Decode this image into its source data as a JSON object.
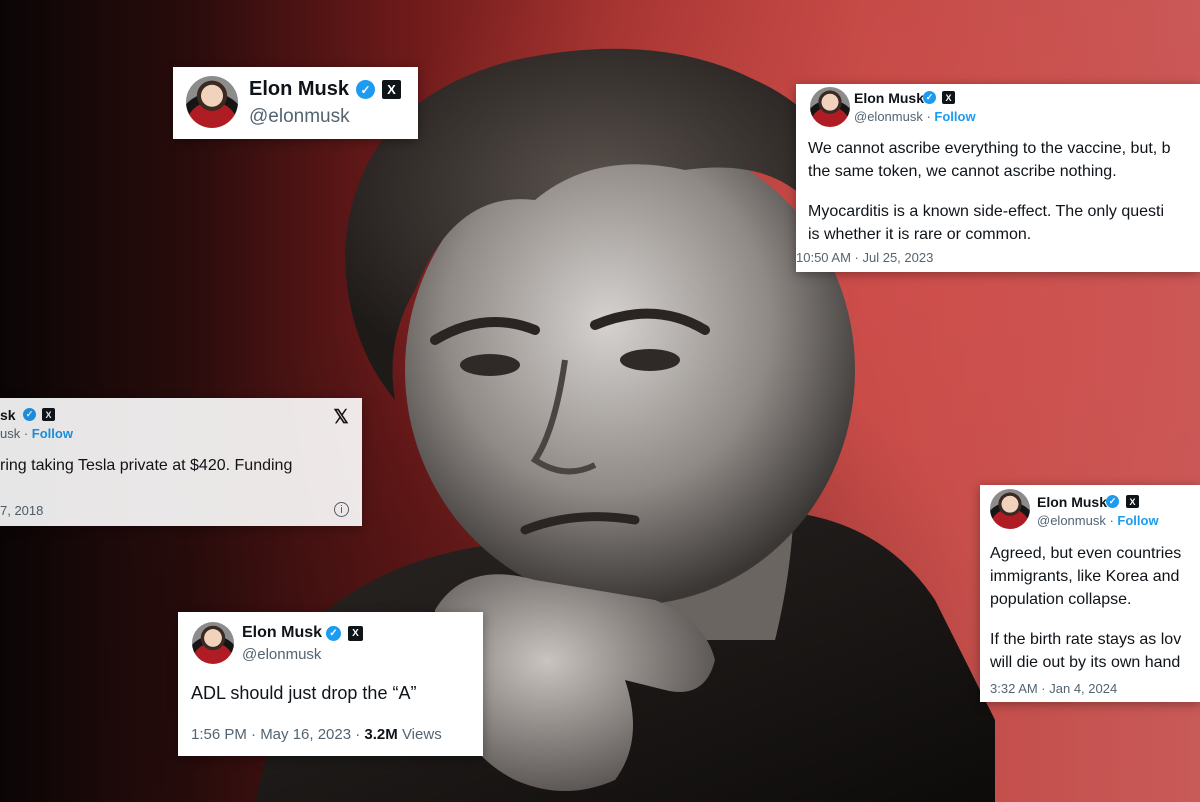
{
  "author": {
    "name": "Elon Musk",
    "handle": "@elonmusk",
    "follow_label": "Follow"
  },
  "cards": {
    "header": {
      "name": "Elon Musk",
      "handle": "@elonmusk"
    },
    "vaccine": {
      "name": "Elon Musk",
      "handle": "@elonmusk",
      "follow": "Follow",
      "line1": "We cannot ascribe everything to the vaccine, but, b",
      "line2": "the same token, we cannot ascribe nothing.",
      "line3": "Myocarditis is a known side-effect. The only questi",
      "line4": "is whether it is rare or common.",
      "timestamp": "10:50 AM · Jul 25, 2023"
    },
    "tesla": {
      "name_fragment": "sk",
      "handle_fragment": "usk",
      "follow": "Follow",
      "text_fragment": "ring taking Tesla private at $420. Funding",
      "date_fragment": "7, 2018"
    },
    "adl": {
      "name": "Elon Musk",
      "handle": "@elonmusk",
      "text": "ADL should just drop the “A”",
      "timestamp": "1:56 PM · May 16, 2023 · ",
      "views_count": "3.2M",
      "views_label": " Views"
    },
    "birth": {
      "name": "Elon Musk",
      "handle": "@elonmusk",
      "follow": "Follow",
      "line1": "Agreed, but even countries",
      "line2": "immigrants, like Korea and",
      "line3": "population collapse.",
      "line4": "If the birth rate stays as lov",
      "line5": "will die out by its own hand",
      "timestamp": "3:32 AM · Jan 4, 2024"
    }
  },
  "icons": {
    "verified": "verified-badge-icon",
    "x_logo": "x-logo-icon",
    "info": "info-icon"
  },
  "colors": {
    "background_red": "#c24844",
    "verified_blue": "#1d9bf0",
    "text_dark": "#0f1419",
    "text_muted": "#536471"
  }
}
